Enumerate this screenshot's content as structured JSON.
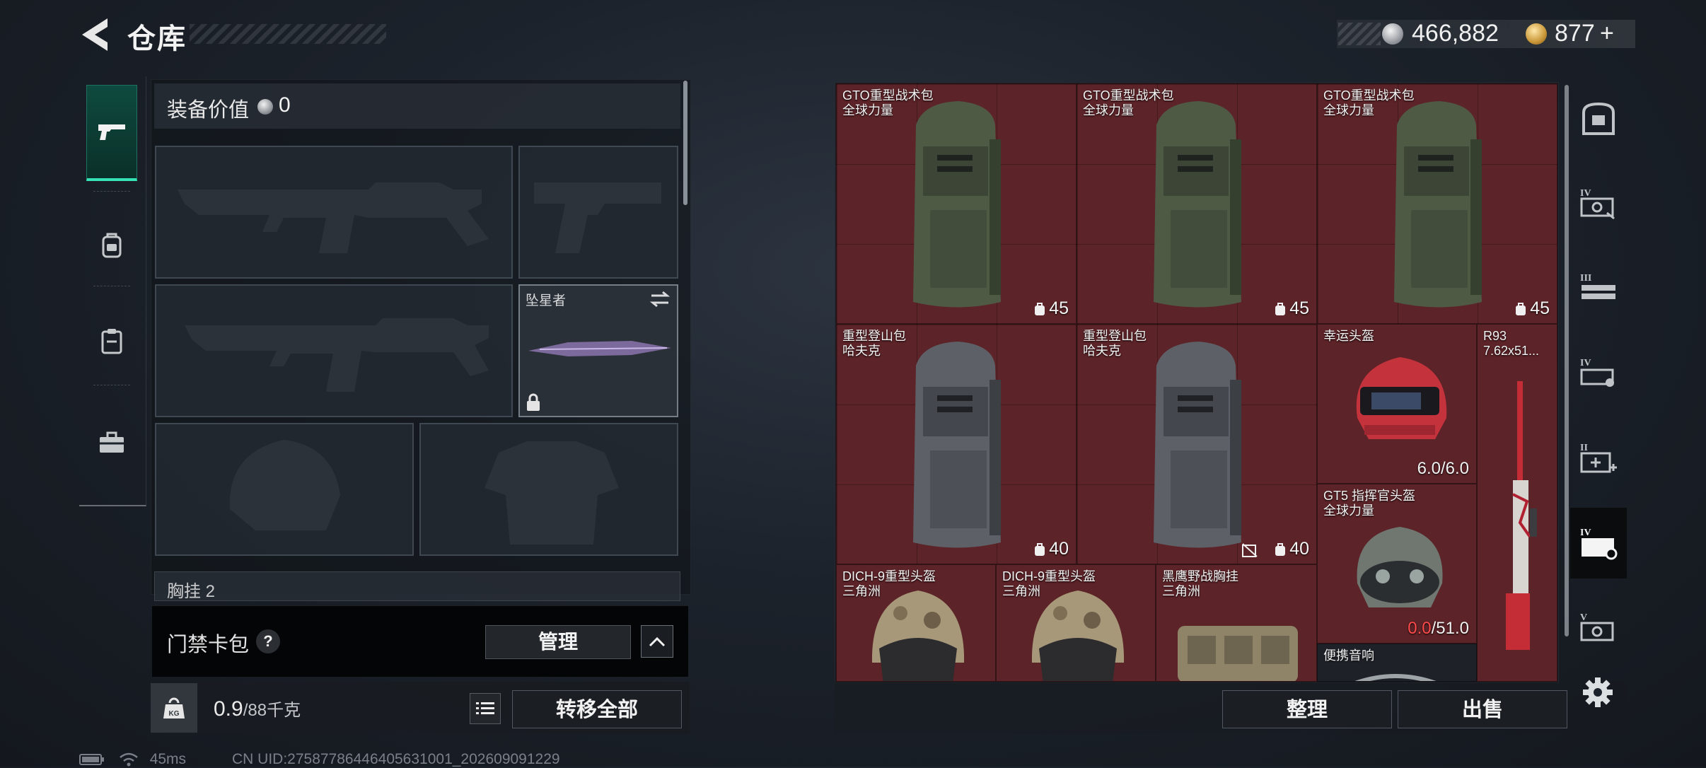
{
  "header": {
    "title": "仓库",
    "silver_amount": "466,882",
    "gold_amount": "877",
    "gold_plus": "+"
  },
  "left_nav": {
    "items": [
      {
        "name": "weapons",
        "icon": "pistol-icon",
        "active": true
      },
      {
        "name": "gear",
        "icon": "backpack-icon",
        "active": false
      },
      {
        "name": "consumables",
        "icon": "clipboard-icon",
        "active": false
      },
      {
        "name": "toolbox",
        "icon": "toolbox-icon",
        "active": false
      }
    ]
  },
  "equipment": {
    "value_label": "装备价值",
    "value": "0",
    "melee_name": "坠星者",
    "partial_slot_label": "胸挂",
    "partial_slot_count": "2"
  },
  "access_card": {
    "label": "门禁卡包",
    "help": "?",
    "manage_label": "管理"
  },
  "weight": {
    "current": "0.9",
    "max": "/88",
    "unit": "千克",
    "kg_badge": "KG",
    "transfer_all_label": "转移全部"
  },
  "status": {
    "ping": "45ms",
    "uid": "CN UID:27587786446405631001_202609091229"
  },
  "storage": {
    "items": [
      {
        "name": "GTO重型战术包",
        "sub": "全球力量",
        "capacity": "45"
      },
      {
        "name": "GTO重型战术包",
        "sub": "全球力量",
        "capacity": "45"
      },
      {
        "name": "GTO重型战术包",
        "sub": "全球力量",
        "capacity": "45"
      },
      {
        "name": "重型登山包",
        "sub": "哈夫克",
        "capacity": "40"
      },
      {
        "name": "重型登山包",
        "sub": "哈夫克",
        "capacity": "40"
      },
      {
        "name": "幸运头盔",
        "sub": "",
        "durability": "6.0/6.0"
      },
      {
        "name": "R93",
        "sub": "7.62x51..."
      },
      {
        "name": "GT5 指挥官头盔",
        "sub": "全球力量",
        "durability_current": "0.0",
        "durability_max": "/51.0"
      },
      {
        "name": "DICH-9重型头盔",
        "sub": "三角洲"
      },
      {
        "name": "DICH-9重型头盔",
        "sub": "三角洲"
      },
      {
        "name": "黑鹰野战胸挂",
        "sub": "三角洲"
      },
      {
        "name": "便携音响",
        "sub": ""
      }
    ],
    "sort_label": "整理",
    "sell_label": "出售"
  },
  "right_sidebar": {
    "items": [
      {
        "icon": "safe-box-icon",
        "tier": ""
      },
      {
        "icon": "tier-iv-case-icon",
        "tier": "IV"
      },
      {
        "icon": "tier-iii-case-icon",
        "tier": "III"
      },
      {
        "icon": "tier-iv-case-icon",
        "tier": "IV"
      },
      {
        "icon": "tier-ii-medkit-icon",
        "tier": "II"
      },
      {
        "icon": "tier-iv-case-icon",
        "tier": "IV"
      },
      {
        "icon": "tier-v-case-icon",
        "tier": "V"
      }
    ]
  },
  "colors": {
    "accent": "#36e3b6",
    "item_bg_red": "#5c2328",
    "durability_low": "#ff4a4a"
  }
}
